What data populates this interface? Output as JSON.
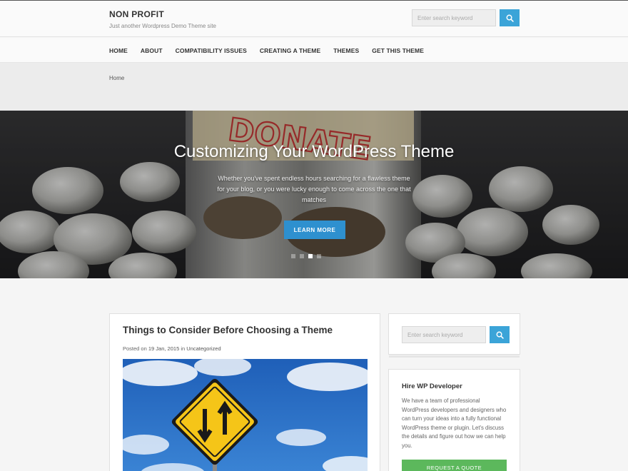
{
  "site": {
    "title": "NON PROFIT",
    "tagline": "Just another Wordpress Demo Theme site"
  },
  "header_search": {
    "placeholder": "Enter search keyword",
    "button_icon": "search-icon"
  },
  "nav": {
    "items": [
      {
        "label": "HOME"
      },
      {
        "label": "ABOUT"
      },
      {
        "label": "COMPATIBILITY ISSUES"
      },
      {
        "label": "CREATING A THEME"
      },
      {
        "label": "THEMES"
      },
      {
        "label": "GET THIS THEME"
      }
    ]
  },
  "breadcrumb": {
    "home": "Home"
  },
  "hero": {
    "title": "Customizing Your WordPress Theme",
    "text": "Whether you've spent endless hours searching for a flawless theme for your blog, or you were lucky enough to come across the one that matches",
    "button": "LEARN MORE",
    "jar_label": "DONATE",
    "slide_count": 4,
    "active_slide": 3
  },
  "post": {
    "title": "Things to Consider Before Choosing a Theme",
    "posted_on": "Posted on",
    "date": "19 Jan, 2015",
    "in": "in",
    "category": "Uncategorized"
  },
  "sidebar": {
    "search": {
      "placeholder": "Enter search keyword",
      "button_icon": "search-icon"
    },
    "hire": {
      "title": "Hire WP Developer",
      "text": "We have a team of professional WordPress developers and designers who can turn your ideas into a fully functional WordPress theme or plugin. Let's discuss the details and figure out how we can help you.",
      "button": "REQUEST A QUOTE"
    }
  },
  "colors": {
    "accent_blue": "#3ba4d8",
    "button_blue": "#2e90cf",
    "quote_green": "#5cb85c",
    "sign_yellow": "#f5c518",
    "donate_red": "#d03a3a"
  }
}
